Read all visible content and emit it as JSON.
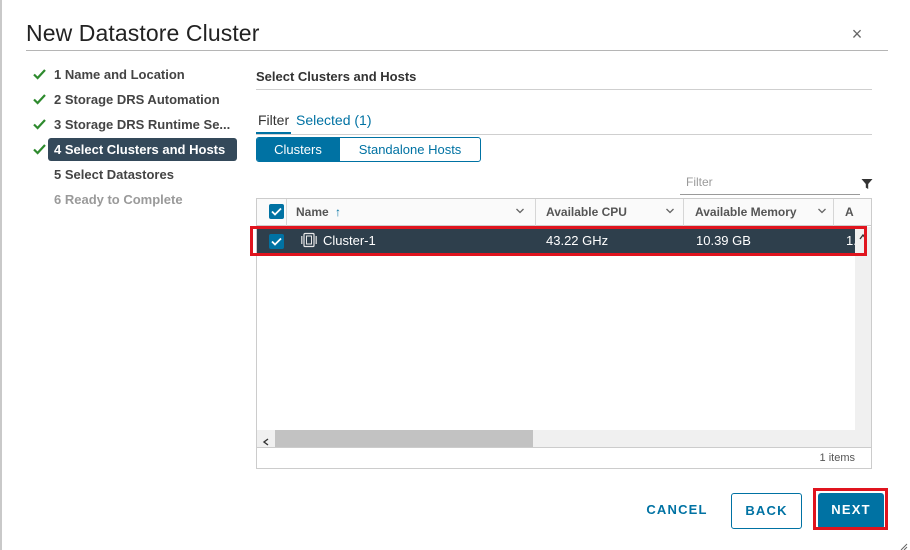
{
  "dialog": {
    "title": "New Datastore Cluster",
    "close_icon": "close-icon"
  },
  "steps": [
    {
      "label": "1 Name and Location",
      "state": "done"
    },
    {
      "label": "2 Storage DRS Automation",
      "state": "done"
    },
    {
      "label": "3 Storage DRS Runtime Se...",
      "state": "done"
    },
    {
      "label": "4 Select Clusters and Hosts",
      "state": "active"
    },
    {
      "label": "5 Select Datastores",
      "state": "pending"
    },
    {
      "label": "6 Ready to Complete",
      "state": "disabled"
    }
  ],
  "main": {
    "section_title": "Select Clusters and Hosts",
    "tabs": {
      "filter": "Filter",
      "selected": "Selected (1)"
    },
    "segments": {
      "clusters": "Clusters",
      "standalone_hosts": "Standalone Hosts"
    },
    "filter_input": {
      "placeholder": "Filter",
      "value": ""
    },
    "grid": {
      "columns": [
        "Name",
        "Available CPU",
        "Available Memory",
        "A"
      ],
      "sort_indicator": "↑",
      "rows": [
        {
          "name": "Cluster-1",
          "cpu": "43.22 GHz",
          "memory": "10.39 GB",
          "extra": "1.",
          "checked": true
        }
      ],
      "footer": "1 items"
    }
  },
  "footer": {
    "cancel": "CANCEL",
    "back": "BACK",
    "next": "NEXT"
  },
  "colors": {
    "accent": "#0072a3",
    "active_step_bg": "#34495a",
    "selected_row_bg": "#2e3f4c",
    "check_green": "#2e8a2e",
    "highlight_red": "#e0141e"
  }
}
